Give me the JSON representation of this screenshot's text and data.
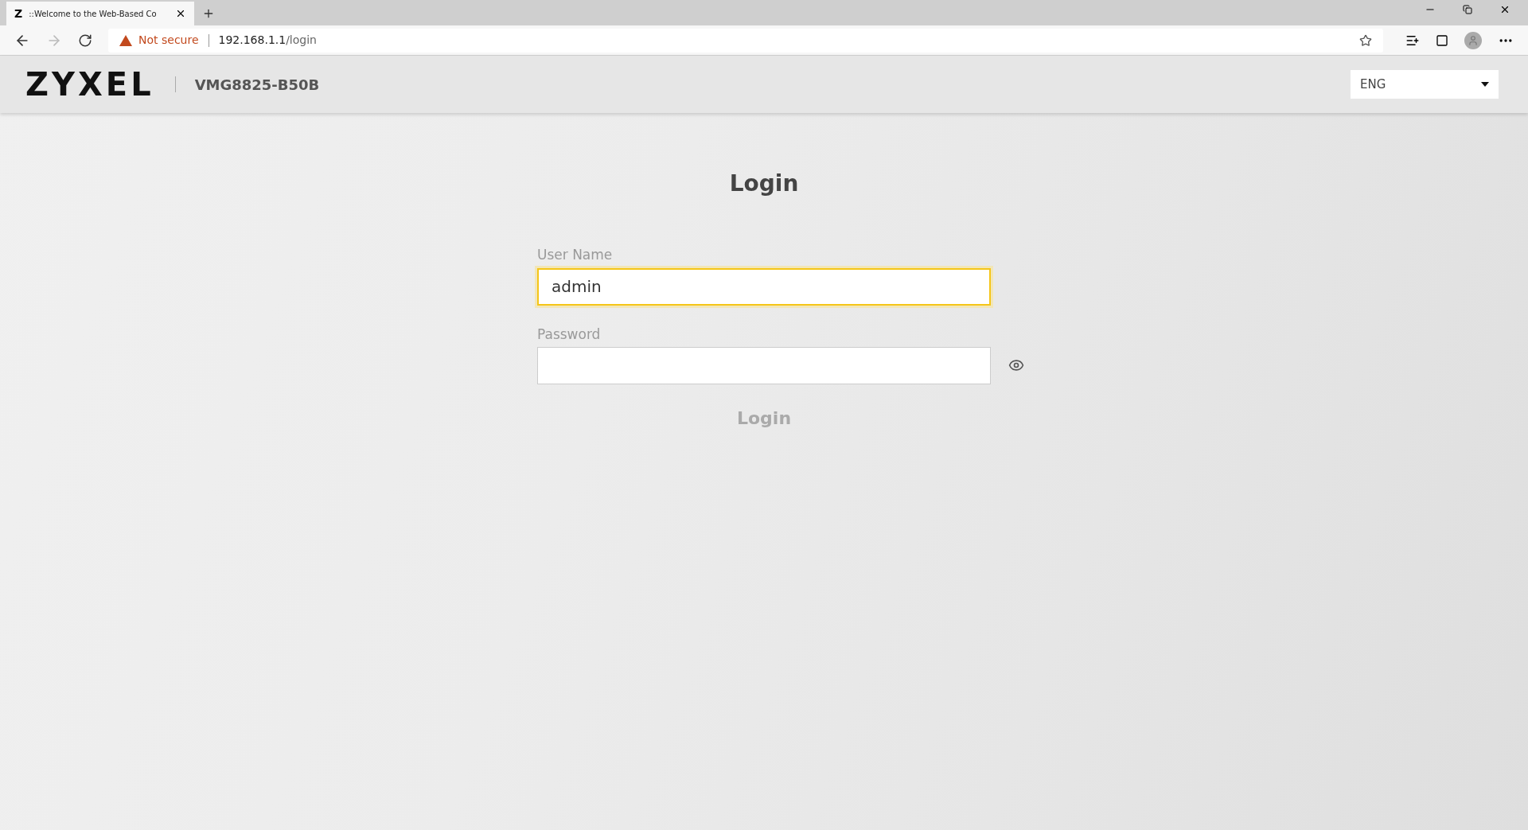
{
  "browser": {
    "tab": {
      "favicon": "Z",
      "title": "::Welcome to the Web-Based Co",
      "selected": true
    },
    "security": "Not secure",
    "url_host": "192.168.1.1",
    "url_path": "/login"
  },
  "header": {
    "logo": "ZYXEL",
    "model": "VMG8825-B50B",
    "language": "ENG"
  },
  "login": {
    "title": "Login",
    "fields": [
      {
        "label": "User Name",
        "value": "admin",
        "focused": true,
        "kind": "text"
      },
      {
        "label": "Password",
        "focused": false,
        "kind": "password"
      }
    ],
    "button": {
      "label": "Login",
      "disabled": true
    }
  }
}
